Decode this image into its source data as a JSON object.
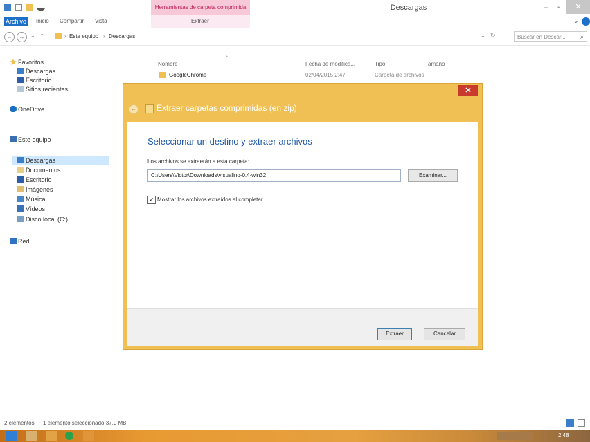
{
  "window": {
    "title": "Descargas",
    "context_tab_header": "Herramientas de carpeta comprimida",
    "minimize": "–",
    "maximize": "▫",
    "close": "✕"
  },
  "ribbon": {
    "tabs": [
      "Archivo",
      "Inicio",
      "Compartir",
      "Vista"
    ],
    "context_tab": "Extraer",
    "collapse": "⌄"
  },
  "address": {
    "back": "←",
    "forward": "→",
    "recent": "⌄",
    "up": "↑",
    "crumbs": [
      "Este equipo",
      "Descargas"
    ],
    "separator": "›",
    "refresh": "↻",
    "search_placeholder": "Buscar en Descar...",
    "search_icon": "⌕"
  },
  "nav": {
    "favorites_header": "Favoritos",
    "favorites": [
      "Descargas",
      "Escritorio",
      "Sitios recientes"
    ],
    "onedrive": "OneDrive",
    "this_pc_header": "Este equipo",
    "this_pc": [
      "Descargas",
      "Documentos",
      "Escritorio",
      "Imágenes",
      "Música",
      "Vídeos",
      "Disco local (C:)"
    ],
    "network": "Red",
    "selected": "Descargas"
  },
  "file_list": {
    "columns": [
      "Nombre",
      "Fecha de modifica...",
      "Tipo",
      "Tamaño"
    ],
    "sort_indicator": "ˆ",
    "rows": [
      {
        "name": "GoogleChrome",
        "date": "02/04/2015 2:47",
        "type": "Carpeta de archivos",
        "size": ""
      }
    ]
  },
  "dialog": {
    "title": "Extraer carpetas comprimidas (en zip)",
    "back": "←",
    "close": "✕",
    "heading": "Seleccionar un destino y extraer archivos",
    "dest_label": "Los archivos se extraerán a esta carpeta:",
    "path": "C:\\Users\\Victor\\Downloads\\visualino-0.4-win32",
    "browse_label": "Examinar...",
    "checkbox_checked": true,
    "checkbox_mark": "✓",
    "checkbox_label": "Mostrar los archivos extraídos al completar",
    "extract_label": "Extraer",
    "cancel_label": "Cancelar"
  },
  "status": {
    "count": "2 elementos",
    "selection": "1 elemento seleccionado  37,0 MB"
  },
  "taskbar": {
    "time": "2:48"
  },
  "colors": {
    "accent_blue": "#1e6fc8",
    "dialog_frame": "#f0c054",
    "close_red": "#c73a2c",
    "heading_blue": "#1f5aa6"
  }
}
